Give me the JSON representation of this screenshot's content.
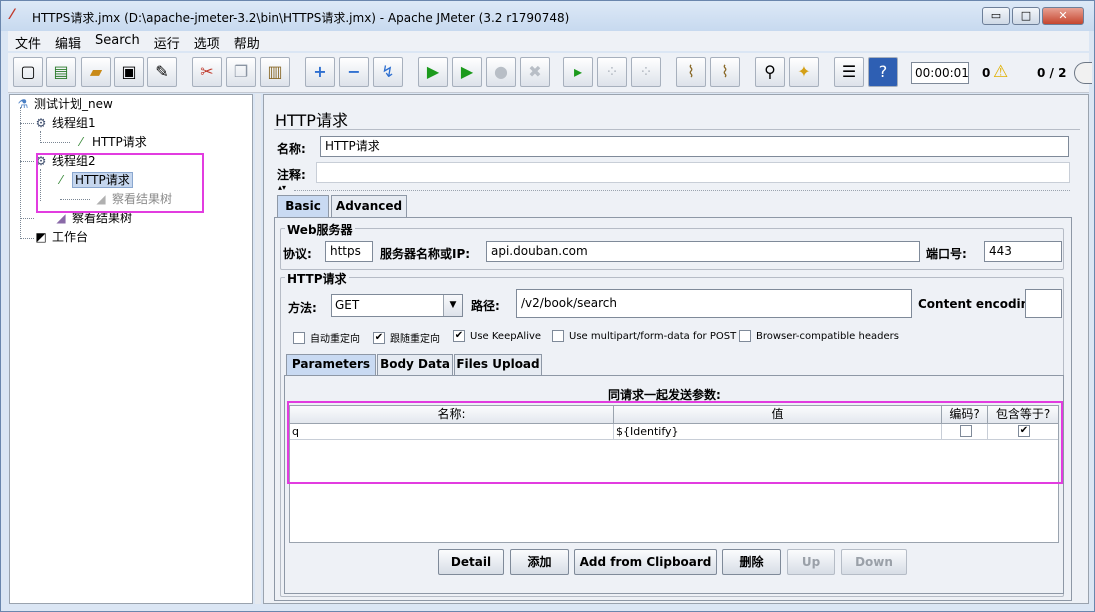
{
  "window": {
    "title": "HTTPS请求.jmx (D:\\apache-jmeter-3.2\\bin\\HTTPS请求.jmx) - Apache JMeter (3.2 r1790748)",
    "min_glyph": "▭",
    "max_glyph": "□",
    "close_glyph": "✕"
  },
  "menu": [
    "文件",
    "编辑",
    "Search",
    "运行",
    "选项",
    "帮助"
  ],
  "toolbar": {
    "elapsed": "00:00:01",
    "warnings": "0",
    "threads": "0 / 2"
  },
  "tree": {
    "root": "测试计划_new",
    "group1": "线程组1",
    "group1_sampler": "HTTP请求",
    "group2": "线程组2",
    "group2_sampler": "HTTP请求",
    "group2_listener": "察看结果树",
    "listener": "察看结果树",
    "workbench": "工作台"
  },
  "panel": {
    "title": "HTTP请求",
    "name_label": "名称:",
    "name_value": "HTTP请求",
    "comment_label": "注释:",
    "comment_value": "",
    "tabs": [
      "Basic",
      "Advanced"
    ],
    "web_server": {
      "title": "Web服务器",
      "protocol_label": "协议:",
      "protocol_value": "https",
      "server_label": "服务器名称或IP:",
      "server_value": "api.douban.com",
      "port_label": "端口号:",
      "port_value": "443"
    },
    "http_request": {
      "title": "HTTP请求",
      "method_label": "方法:",
      "method_value": "GET",
      "path_label": "路径:",
      "path_value": "/v2/book/search",
      "encoding_label": "Content encoding:",
      "encoding_value": ""
    },
    "options": [
      {
        "label": "自动重定向",
        "checked": false
      },
      {
        "label": "跟随重定向",
        "checked": true
      },
      {
        "label": "Use KeepAlive",
        "checked": true
      },
      {
        "label": "Use multipart/form-data for POST",
        "checked": false
      },
      {
        "label": "Browser-compatible headers",
        "checked": false
      }
    ],
    "subtabs": [
      "Parameters",
      "Body Data",
      "Files Upload"
    ],
    "params": {
      "caption": "同请求一起发送参数:",
      "columns": [
        "名称:",
        "值",
        "编码?",
        "包含等于?"
      ],
      "rows": [
        {
          "name": "q",
          "value": "${Identify}",
          "encode": false,
          "include_equals": true
        }
      ]
    },
    "buttons": {
      "detail": "Detail",
      "add": "添加",
      "clipboard": "Add from Clipboard",
      "delete": "删除",
      "up": "Up",
      "down": "Down"
    }
  },
  "colors": {
    "highlight": "#e23ce0",
    "selection": "#c5d6ee"
  }
}
